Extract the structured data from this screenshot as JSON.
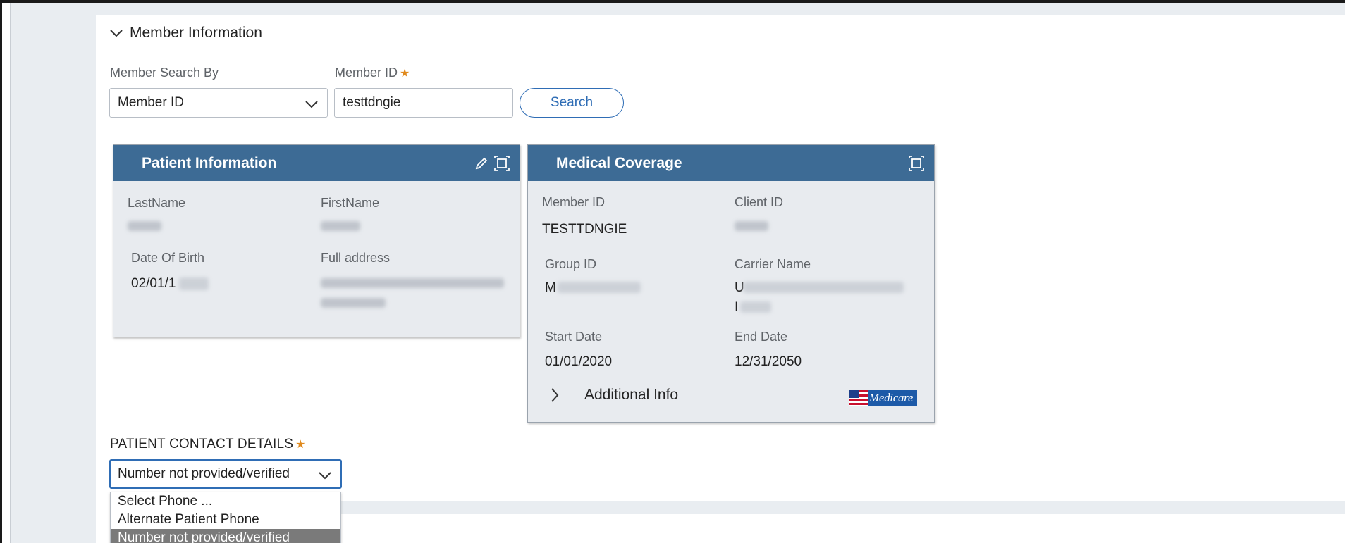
{
  "section": {
    "title": "Member Information"
  },
  "search": {
    "search_by_label": "Member Search By",
    "search_by_value": "Member ID",
    "member_id_label": "Member ID",
    "member_id_value": "testtdngie",
    "search_button": "Search"
  },
  "patient_card": {
    "title": "Patient Information",
    "last_name_label": "LastName",
    "first_name_label": "FirstName",
    "dob_label": "Date Of Birth",
    "dob_value_visible": "02/01/1",
    "address_label": "Full address"
  },
  "coverage_card": {
    "title": "Medical Coverage",
    "member_id_label": "Member ID",
    "member_id_value": "TESTTDNGIE",
    "client_id_label": "Client ID",
    "group_id_label": "Group ID",
    "group_id_visible": "M",
    "carrier_label": "Carrier Name",
    "carrier_visible_1": "U",
    "carrier_visible_2": "I",
    "start_label": "Start Date",
    "start_value": "01/01/2020",
    "end_label": "End Date",
    "end_value": "12/31/2050",
    "additional_info": "Additional Info",
    "medicare_logo_text": "Medicare"
  },
  "contact": {
    "label": "PATIENT CONTACT DETAILS",
    "selected": "Number not provided/verified",
    "options": [
      "Select Phone ...",
      "Alternate Patient Phone",
      "Number not provided/verified"
    ]
  },
  "colors": {
    "card_header": "#3d6b95",
    "accent": "#2f6db5",
    "required": "#e08a1e"
  }
}
